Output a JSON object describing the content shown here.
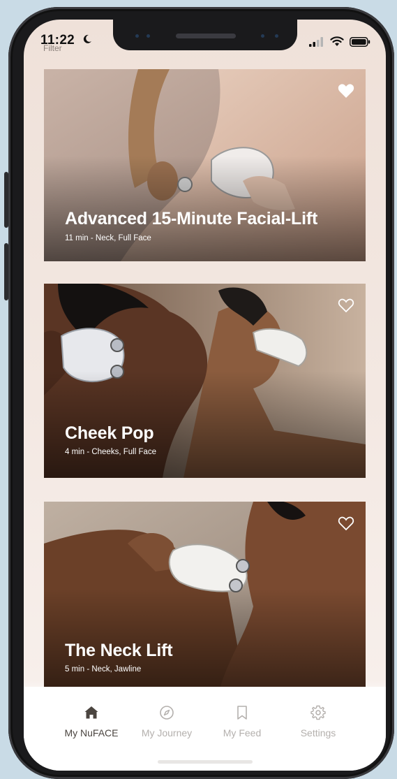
{
  "status_bar": {
    "time": "11:22",
    "moon_icon": "moon-icon",
    "signal_icon": "cellular-signal-icon",
    "wifi_icon": "wifi-icon",
    "battery_icon": "battery-icon"
  },
  "header": {
    "filter_label": "Filter"
  },
  "cards": [
    {
      "title": "Advanced 15-Minute Facial-Lift",
      "meta": "11 min - Neck, Full Face",
      "favorited": true
    },
    {
      "title": "Cheek Pop",
      "meta": "4 min - Cheeks, Full Face",
      "favorited": false
    },
    {
      "title": "The Neck Lift",
      "meta": "5 min - Neck, Jawline",
      "favorited": false
    }
  ],
  "tabbar": {
    "tabs": [
      {
        "label": "My NuFACE",
        "icon": "home-icon",
        "active": true
      },
      {
        "label": "My Journey",
        "icon": "compass-icon",
        "active": false
      },
      {
        "label": "My Feed",
        "icon": "bookmark-icon",
        "active": false
      },
      {
        "label": "Settings",
        "icon": "gear-icon",
        "active": false
      }
    ]
  },
  "colors": {
    "screen_background": "#f3e8e2",
    "active_tab": "#4b4540",
    "inactive_tab": "#b4b0ad"
  }
}
